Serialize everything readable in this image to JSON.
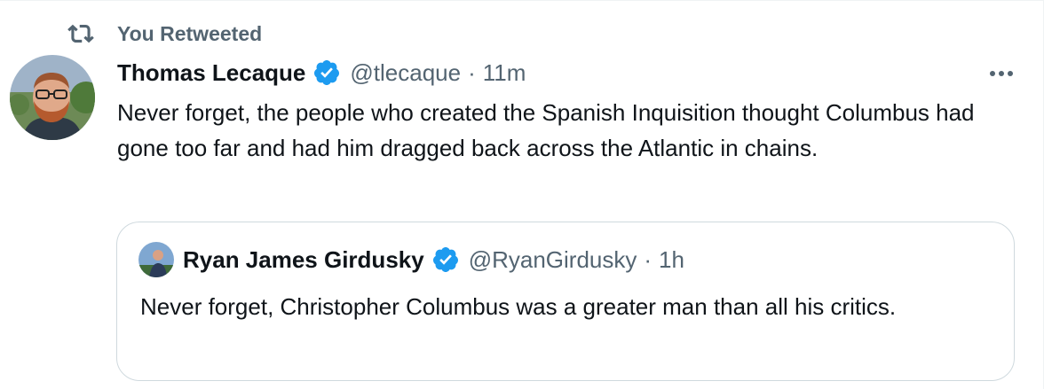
{
  "retweet": {
    "label": "You Retweeted",
    "icon": "retweet-icon"
  },
  "tweet": {
    "author_name": "Thomas Lecaque",
    "handle": "@tlecaque",
    "separator": "·",
    "time": "11m",
    "text": "Never forget, the people who created the Spanish Inquisition thought Columbus had gone too far and had him dragged back across the Atlantic in chains.",
    "more_icon": "more-horizontal-icon",
    "verified_icon": "verified-badge-icon"
  },
  "quote": {
    "author_name": "Ryan James Girdusky",
    "handle": "@RyanGirdusky",
    "separator": "·",
    "time": "1h",
    "text": "Never forget, Christopher Columbus was a greater man than all his critics.",
    "verified_icon": "verified-badge-icon"
  },
  "colors": {
    "primary_text": "#0f1419",
    "secondary_text": "#536471",
    "verified_blue": "#1d9bf0",
    "border": "#cfd9de"
  }
}
